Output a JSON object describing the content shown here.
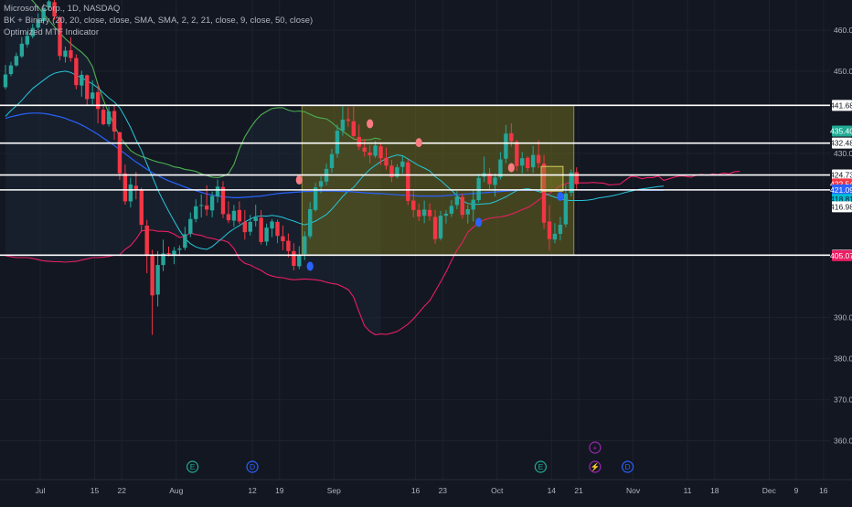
{
  "legend": {
    "line1": "Microsoft Corp., 1D, NASDAQ",
    "line2": "BK + Binary (20, 20, close, close, SMA, SMA, 2, 2, 21, close, 9, close, 50, close)",
    "line3": "Optimized MTF Indicator"
  },
  "colors": {
    "background": "#131722",
    "grid": "#1e222d",
    "bull": "#26a69a",
    "bear": "#f23645",
    "box_fill": "#6b6a1e",
    "upper_band": "#4caf50",
    "lower_band": "#e91e63",
    "mid_band": "#26c6da",
    "sma50": "#2962ff",
    "dot_blue": "#2962ff",
    "dot_red": "#f77c80"
  },
  "chart_data": {
    "type": "candlestick",
    "ylim": [
      355,
      470
    ],
    "y_ticks": [
      "460.00",
      "450.00",
      "430.00",
      "390.00",
      "380.00",
      "370.00",
      "360.00"
    ],
    "x_labels": [
      "Jul",
      "15",
      "22",
      "Aug",
      "12",
      "19",
      "Sep",
      "16",
      "23",
      "Oct",
      "14",
      "21",
      "Nov",
      "11",
      "18",
      "Dec",
      "9",
      "16"
    ],
    "x_label_index": [
      0,
      10,
      15,
      25,
      39,
      44,
      54,
      69,
      74,
      84,
      94,
      99,
      109,
      119,
      124,
      134,
      139,
      144
    ],
    "candles": [
      {
        "o": 446.1,
        "h": 451.5,
        "l": 445.6,
        "c": 449.2
      },
      {
        "o": 449.3,
        "h": 452.3,
        "l": 448.8,
        "c": 451.4
      },
      {
        "o": 451.4,
        "h": 454.5,
        "l": 451.1,
        "c": 453.7
      },
      {
        "o": 453.6,
        "h": 458.3,
        "l": 453.2,
        "c": 456.7
      },
      {
        "o": 456.5,
        "h": 459.6,
        "l": 455.8,
        "c": 458.6
      },
      {
        "o": 458.5,
        "h": 461.5,
        "l": 458.0,
        "c": 460.5
      },
      {
        "o": 460.6,
        "h": 464.1,
        "l": 460.0,
        "c": 462.6
      },
      {
        "o": 462.2,
        "h": 466.4,
        "l": 461.5,
        "c": 465.4
      },
      {
        "o": 465.5,
        "h": 468.5,
        "l": 464.8,
        "c": 467.0
      },
      {
        "o": 466.8,
        "h": 469.0,
        "l": 462.5,
        "c": 463.3
      },
      {
        "o": 463.1,
        "h": 463.4,
        "l": 452.6,
        "c": 453.7
      },
      {
        "o": 453.5,
        "h": 456.0,
        "l": 452.1,
        "c": 455.0
      },
      {
        "o": 455.1,
        "h": 458.3,
        "l": 452.3,
        "c": 453.2
      },
      {
        "o": 453.2,
        "h": 454.1,
        "l": 445.6,
        "c": 446.6
      },
      {
        "o": 446.5,
        "h": 450.1,
        "l": 443.8,
        "c": 449.1
      },
      {
        "o": 449.0,
        "h": 449.2,
        "l": 441.8,
        "c": 443.2
      },
      {
        "o": 443.3,
        "h": 447.8,
        "l": 441.6,
        "c": 444.8
      },
      {
        "o": 444.9,
        "h": 446.8,
        "l": 437.3,
        "c": 440.8
      },
      {
        "o": 440.6,
        "h": 442.0,
        "l": 436.8,
        "c": 437.1
      },
      {
        "o": 437.1,
        "h": 441.4,
        "l": 436.5,
        "c": 440.2
      },
      {
        "o": 440.3,
        "h": 441.6,
        "l": 433.3,
        "c": 435.3
      },
      {
        "o": 435.1,
        "h": 435.3,
        "l": 423.5,
        "c": 425.1
      },
      {
        "o": 425.1,
        "h": 427.3,
        "l": 417.5,
        "c": 418.3
      },
      {
        "o": 418.3,
        "h": 424.1,
        "l": 416.8,
        "c": 422.4
      },
      {
        "o": 422.1,
        "h": 425.5,
        "l": 418.8,
        "c": 421.0
      },
      {
        "o": 421.0,
        "h": 421.6,
        "l": 411.0,
        "c": 412.6
      },
      {
        "o": 412.4,
        "h": 413.8,
        "l": 400.8,
        "c": 405.2
      },
      {
        "o": 405.0,
        "h": 406.5,
        "l": 385.8,
        "c": 395.4
      },
      {
        "o": 395.6,
        "h": 406.2,
        "l": 392.7,
        "c": 402.8
      },
      {
        "o": 402.8,
        "h": 409.0,
        "l": 401.3,
        "c": 405.6
      },
      {
        "o": 405.7,
        "h": 407.3,
        "l": 404.9,
        "c": 405.5
      },
      {
        "o": 405.4,
        "h": 407.2,
        "l": 403.0,
        "c": 406.3
      },
      {
        "o": 406.5,
        "h": 407.6,
        "l": 405.0,
        "c": 406.8
      },
      {
        "o": 407.0,
        "h": 412.1,
        "l": 406.4,
        "c": 410.3
      },
      {
        "o": 410.4,
        "h": 415.6,
        "l": 409.6,
        "c": 414.0
      },
      {
        "o": 414.0,
        "h": 418.8,
        "l": 413.2,
        "c": 417.1
      },
      {
        "o": 417.3,
        "h": 420.0,
        "l": 414.4,
        "c": 417.4
      },
      {
        "o": 417.3,
        "h": 422.2,
        "l": 414.8,
        "c": 416.3
      },
      {
        "o": 416.1,
        "h": 420.7,
        "l": 414.4,
        "c": 419.6
      },
      {
        "o": 419.5,
        "h": 423.6,
        "l": 418.0,
        "c": 421.9
      },
      {
        "o": 421.8,
        "h": 423.2,
        "l": 414.2,
        "c": 415.2
      },
      {
        "o": 415.2,
        "h": 418.3,
        "l": 413.0,
        "c": 413.7
      },
      {
        "o": 413.6,
        "h": 417.4,
        "l": 412.1,
        "c": 416.0
      },
      {
        "o": 416.2,
        "h": 418.3,
        "l": 412.8,
        "c": 413.4
      },
      {
        "o": 413.3,
        "h": 416.2,
        "l": 409.0,
        "c": 410.8
      },
      {
        "o": 410.9,
        "h": 415.0,
        "l": 410.0,
        "c": 413.3
      },
      {
        "o": 413.5,
        "h": 417.5,
        "l": 412.2,
        "c": 414.4
      },
      {
        "o": 414.3,
        "h": 416.2,
        "l": 407.8,
        "c": 408.4
      },
      {
        "o": 408.5,
        "h": 412.9,
        "l": 407.5,
        "c": 411.9
      },
      {
        "o": 411.7,
        "h": 414.0,
        "l": 409.6,
        "c": 413.4
      },
      {
        "o": 413.3,
        "h": 413.8,
        "l": 408.1,
        "c": 409.9
      },
      {
        "o": 409.8,
        "h": 412.4,
        "l": 406.4,
        "c": 408.6
      },
      {
        "o": 408.7,
        "h": 410.5,
        "l": 404.7,
        "c": 406.2
      },
      {
        "o": 406.2,
        "h": 408.1,
        "l": 401.5,
        "c": 402.6
      },
      {
        "o": 402.5,
        "h": 407.4,
        "l": 401.8,
        "c": 405.3
      },
      {
        "o": 405.5,
        "h": 411.0,
        "l": 404.0,
        "c": 409.8
      },
      {
        "o": 409.8,
        "h": 418.1,
        "l": 409.2,
        "c": 416.4
      },
      {
        "o": 416.2,
        "h": 422.8,
        "l": 415.8,
        "c": 421.7
      },
      {
        "o": 421.9,
        "h": 424.4,
        "l": 420.3,
        "c": 423.2
      },
      {
        "o": 423.1,
        "h": 427.5,
        "l": 422.2,
        "c": 426.2
      },
      {
        "o": 426.4,
        "h": 431.1,
        "l": 425.3,
        "c": 429.8
      },
      {
        "o": 429.9,
        "h": 437.0,
        "l": 428.9,
        "c": 435.5
      },
      {
        "o": 435.5,
        "h": 441.5,
        "l": 434.3,
        "c": 438.2
      },
      {
        "o": 438.3,
        "h": 441.2,
        "l": 436.5,
        "c": 437.9
      },
      {
        "o": 437.8,
        "h": 441.4,
        "l": 433.4,
        "c": 434.2
      },
      {
        "o": 434.0,
        "h": 437.0,
        "l": 430.8,
        "c": 431.6
      },
      {
        "o": 431.4,
        "h": 433.5,
        "l": 429.2,
        "c": 430.4
      },
      {
        "o": 430.2,
        "h": 432.0,
        "l": 427.6,
        "c": 429.5
      },
      {
        "o": 429.4,
        "h": 433.0,
        "l": 428.9,
        "c": 431.9
      },
      {
        "o": 431.7,
        "h": 432.7,
        "l": 427.2,
        "c": 428.8
      },
      {
        "o": 428.9,
        "h": 431.4,
        "l": 426.0,
        "c": 427.0
      },
      {
        "o": 427.0,
        "h": 428.4,
        "l": 423.0,
        "c": 424.2
      },
      {
        "o": 424.3,
        "h": 427.3,
        "l": 423.9,
        "c": 426.6
      },
      {
        "o": 426.7,
        "h": 429.3,
        "l": 425.1,
        "c": 428.0
      },
      {
        "o": 427.8,
        "h": 428.5,
        "l": 417.4,
        "c": 418.4
      },
      {
        "o": 418.5,
        "h": 421.3,
        "l": 414.4,
        "c": 416.2
      },
      {
        "o": 416.2,
        "h": 417.8,
        "l": 413.5,
        "c": 414.6
      },
      {
        "o": 414.8,
        "h": 418.5,
        "l": 413.0,
        "c": 416.3
      },
      {
        "o": 416.2,
        "h": 417.8,
        "l": 413.6,
        "c": 414.7
      },
      {
        "o": 414.5,
        "h": 416.2,
        "l": 408.0,
        "c": 409.1
      },
      {
        "o": 409.3,
        "h": 416.0,
        "l": 408.8,
        "c": 414.8
      },
      {
        "o": 414.8,
        "h": 416.2,
        "l": 412.9,
        "c": 415.3
      },
      {
        "o": 415.3,
        "h": 418.6,
        "l": 414.5,
        "c": 417.2
      },
      {
        "o": 417.4,
        "h": 420.8,
        "l": 416.4,
        "c": 419.5
      },
      {
        "o": 419.4,
        "h": 420.2,
        "l": 414.1,
        "c": 415.0
      },
      {
        "o": 415.1,
        "h": 417.5,
        "l": 412.9,
        "c": 416.4
      },
      {
        "o": 416.3,
        "h": 421.3,
        "l": 413.4,
        "c": 418.7
      },
      {
        "o": 418.6,
        "h": 425.0,
        "l": 418.0,
        "c": 424.0
      },
      {
        "o": 424.3,
        "h": 429.2,
        "l": 423.0,
        "c": 425.2
      },
      {
        "o": 425.1,
        "h": 426.4,
        "l": 421.3,
        "c": 422.5
      },
      {
        "o": 422.3,
        "h": 425.1,
        "l": 419.5,
        "c": 424.1
      },
      {
        "o": 424.2,
        "h": 430.3,
        "l": 423.6,
        "c": 428.5
      },
      {
        "o": 428.7,
        "h": 436.9,
        "l": 427.6,
        "c": 434.8
      },
      {
        "o": 434.9,
        "h": 437.3,
        "l": 431.6,
        "c": 432.9
      },
      {
        "o": 432.8,
        "h": 433.3,
        "l": 425.7,
        "c": 426.9
      },
      {
        "o": 427.0,
        "h": 430.3,
        "l": 425.1,
        "c": 428.8
      },
      {
        "o": 428.9,
        "h": 429.3,
        "l": 425.6,
        "c": 426.4
      },
      {
        "o": 426.6,
        "h": 431.8,
        "l": 425.2,
        "c": 429.6
      },
      {
        "o": 429.6,
        "h": 433.2,
        "l": 426.4,
        "c": 427.6
      },
      {
        "o": 427.5,
        "h": 429.6,
        "l": 411.6,
        "c": 413.1
      },
      {
        "o": 413.4,
        "h": 417.4,
        "l": 406.4,
        "c": 409.1
      },
      {
        "o": 409.0,
        "h": 413.0,
        "l": 408.1,
        "c": 410.4
      },
      {
        "o": 410.4,
        "h": 414.5,
        "l": 408.8,
        "c": 412.6
      },
      {
        "o": 412.7,
        "h": 422.3,
        "l": 412.0,
        "c": 420.2
      },
      {
        "o": 420.4,
        "h": 426.1,
        "l": 419.5,
        "c": 425.3
      },
      {
        "o": 425.4,
        "h": 426.6,
        "l": 421.0,
        "c": 422.5
      }
    ],
    "upper_band": [
      468.0,
      469.3,
      469.2,
      468.8,
      468.3,
      467.1,
      465.6,
      464.0,
      462.4,
      460.8,
      459.3,
      457.9,
      456.7,
      455.6,
      454.6,
      453.3,
      451.1,
      446.7,
      443.0,
      439.8,
      436.8,
      434.1,
      432.3,
      430.7,
      429.8,
      429.2,
      428.8,
      428.3,
      427.9,
      427.6,
      427.2,
      426.7,
      426.5,
      426.1,
      425.9,
      425.6,
      425.0,
      424.6,
      424.2,
      424.1,
      424.4,
      425.1,
      427.3,
      431.1,
      434.0,
      436.2,
      438.0,
      439.4,
      440.2,
      440.9,
      441.1,
      441.1,
      440.5,
      440.2,
      440.3,
      440.1,
      439.5,
      438.9,
      438.6,
      438.4,
      437.5,
      436.3,
      435.4,
      434.4,
      433.5,
      433.2,
      433.3,
      433.3,
      433.7,
      433.4
    ],
    "lower_band": [
      405.1,
      404.8,
      404.6,
      404.6,
      404.6,
      404.4,
      404.1,
      403.8,
      403.7,
      403.6,
      403.6,
      403.5,
      403.6,
      403.7,
      404.0,
      404.3,
      404.6,
      404.6,
      404.7,
      404.9,
      405.2,
      405.3,
      406.6,
      407.5,
      409.1,
      411.1,
      411.3,
      411.3,
      411.0,
      411.0,
      410.9,
      410.3,
      409.5,
      409.8,
      410.6,
      410.2,
      410.0,
      409.5,
      409.3,
      408.9,
      408.8,
      408.3,
      406.8,
      404.3,
      403.2,
      402.8,
      402.1,
      401.5,
      400.6,
      400.1,
      399.8,
      399.7,
      399.4,
      399.2,
      399.3,
      399.4,
      399.3,
      399.2,
      399.0,
      398.6,
      398.3,
      398.1,
      397.5,
      396.8,
      395.0,
      391.4,
      388.0,
      386.6,
      385.8,
      386.0,
      385.9,
      386.2,
      386.6,
      387.5,
      388.4,
      389.7,
      391.2,
      392.8,
      394.1,
      396.4,
      398.7,
      401.1,
      403.9,
      406.4,
      408.3,
      410.8,
      412.0,
      413.0,
      413.8,
      414.2,
      414.4,
      414.5,
      414.8,
      415.2,
      415.7,
      416.3,
      416.8,
      417.6,
      418.6,
      419.6,
      420.2,
      421.2,
      422.1,
      422.6,
      423.0,
      422.8,
      422.8,
      422.8,
      422.9,
      422.8,
      422.7,
      422.3,
      422.4,
      422.5,
      423.5,
      424.4,
      424.3,
      423.8,
      424.1,
      424.1,
      424.5,
      423.4,
      423.8,
      424.2,
      424.5,
      424.4,
      424.2,
      424.7,
      424.9,
      424.6,
      425.0,
      424.8,
      425.2,
      425.0,
      425.5,
      425.6
    ],
    "mid_band": [
      439.0,
      440.4,
      441.6,
      442.9,
      444.4,
      445.8,
      446.8,
      447.8,
      448.8,
      449.5,
      449.8,
      450.0,
      449.7,
      449.0,
      448.4,
      447.6,
      446.9,
      445.9,
      444.7,
      443.5,
      442.5,
      441.1,
      438.8,
      436.3,
      433.3,
      430.7,
      427.4,
      424.3,
      421.1,
      418.4,
      415.9,
      413.5,
      411.2,
      409.3,
      408.0,
      407.2,
      406.8,
      406.6,
      407.3,
      408.4,
      409.5,
      410.7,
      411.6,
      412.4,
      413.3,
      414.0,
      414.6,
      414.8,
      414.7,
      414.9,
      414.7,
      414.4,
      413.9,
      413.5,
      413.0,
      412.6,
      413.0,
      413.5,
      414.3,
      415.1,
      416.4,
      417.9,
      419.5,
      420.8,
      421.7,
      423.3,
      424.8,
      426.1,
      427.1,
      428.0,
      428.7,
      429.2,
      429.6,
      429.4,
      428.6,
      427.8,
      427.0,
      426.4,
      425.7,
      424.3,
      423.4,
      422.2,
      421.0,
      419.7,
      418.4,
      417.8,
      417.6,
      417.6,
      417.7,
      417.8,
      418.2,
      418.8,
      419.4,
      420.2,
      420.9,
      421.2,
      421.4,
      421.1,
      420.7,
      420.3,
      419.8,
      419.3,
      418.9,
      418.6,
      418.5,
      418.5,
      418.5,
      418.6,
      418.8,
      419.1,
      419.3,
      419.5,
      419.8,
      420.1,
      420.5,
      420.8,
      421.1,
      421.3,
      421.5,
      421.7,
      421.9,
      422.0
    ],
    "sma50": [
      438.5,
      438.9,
      439.2,
      439.5,
      439.7,
      439.8,
      439.8,
      439.7,
      439.5,
      439.2,
      438.9,
      438.5,
      438.0,
      437.5,
      436.9,
      436.2,
      435.4,
      434.6,
      433.7,
      432.8,
      431.9,
      430.9,
      429.9,
      428.9,
      427.9,
      427.0,
      426.1,
      425.3,
      424.6,
      423.9,
      423.3,
      422.8,
      422.3,
      421.8,
      421.3,
      420.9,
      420.5,
      420.1,
      419.8,
      419.6,
      419.4,
      419.3,
      419.2,
      419.2,
      419.3,
      419.4,
      419.5,
      419.6,
      419.8,
      420.0,
      420.2,
      420.3,
      420.4,
      420.5,
      420.6,
      420.7,
      420.7,
      420.8,
      420.8,
      420.8,
      420.8,
      420.8,
      420.7,
      420.7,
      420.6,
      420.5,
      420.4,
      420.3,
      420.2,
      420.2,
      420.1,
      420.0,
      419.9,
      419.8,
      419.8,
      419.7,
      419.6,
      419.6,
      419.6,
      419.6,
      419.6,
      419.7,
      419.8,
      419.9,
      420.0,
      420.1,
      420.2,
      420.3,
      420.4,
      420.5,
      420.6,
      420.7,
      420.8,
      420.9,
      421.0,
      421.0,
      421.0,
      421.0,
      421.0,
      421.0,
      421.0,
      421.0,
      421.0,
      421.0,
      421.1,
      421.1,
      421.1,
      421.1,
      421.1,
      421.1,
      421.1,
      421.1,
      421.1,
      421.1,
      421.1,
      421.1,
      421.1,
      421.0,
      421.0,
      421.0,
      421.0,
      421.0
    ],
    "h_levels": [
      441.68,
      432.48,
      424.73,
      421.09,
      405.2
    ],
    "price_tags": [
      {
        "label": "441.68",
        "value": 441.68,
        "bg": "#ffffff",
        "fg": "#131722"
      },
      {
        "label": "435.40",
        "value": 435.4,
        "bg": "#22ab94",
        "fg": "#ffffff"
      },
      {
        "label": "432.48",
        "value": 432.48,
        "bg": "#ffffff",
        "fg": "#131722"
      },
      {
        "label": "424.73",
        "value": 424.73,
        "bg": "#ffffff",
        "fg": "#131722"
      },
      {
        "label": "422.54",
        "value": 422.54,
        "bg": "#f23645",
        "fg": "#ffffff"
      },
      {
        "label": "421.09",
        "value": 421.09,
        "bg": "#2962ff",
        "fg": "#ffffff"
      },
      {
        "label": "418.81",
        "value": 418.81,
        "bg": "#00bcd4",
        "fg": "#131722"
      },
      {
        "label": "416.98",
        "value": 416.98,
        "bg": "#ffffff",
        "fg": "#131722"
      },
      {
        "label": "405.20",
        "value": 405.2,
        "bg": "#ffffff",
        "fg": "#131722"
      },
      {
        "label": "405.07",
        "value": 405.07,
        "bg": "#e91e63",
        "fg": "#ffffff"
      }
    ],
    "box": {
      "i0": 55,
      "i1": 104,
      "y0": 441.68,
      "y1": 405.2
    },
    "small_box": {
      "i0": 99,
      "i1": 102,
      "y0": 426.8,
      "y1": 420.8
    },
    "dots_blue": [
      {
        "i": 56,
        "v": 402.5
      },
      {
        "i": 87,
        "v": 413.2
      },
      {
        "i": 102,
        "v": 419.5
      }
    ],
    "dots_red": [
      {
        "i": 54,
        "v": 423.5
      },
      {
        "i": 67,
        "v": 437.2
      },
      {
        "i": 76,
        "v": 432.6
      },
      {
        "i": 93,
        "v": 426.5
      }
    ],
    "events": [
      {
        "i": 28,
        "kind": "earnings",
        "glyph": "E",
        "color": "#22ab94"
      },
      {
        "i": 39,
        "kind": "dividend",
        "glyph": "D",
        "color": "#2962ff"
      },
      {
        "i": 92,
        "kind": "earnings",
        "glyph": "E",
        "color": "#22ab94"
      },
      {
        "i": 102,
        "kind": "split",
        "glyph": "+",
        "color": "#9c27b0"
      },
      {
        "i": 102,
        "kind": "flash",
        "glyph": "⚡",
        "color": "#9c27b0",
        "row": 2
      },
      {
        "i": 108,
        "kind": "dividend",
        "glyph": "D",
        "color": "#2962ff"
      }
    ]
  }
}
